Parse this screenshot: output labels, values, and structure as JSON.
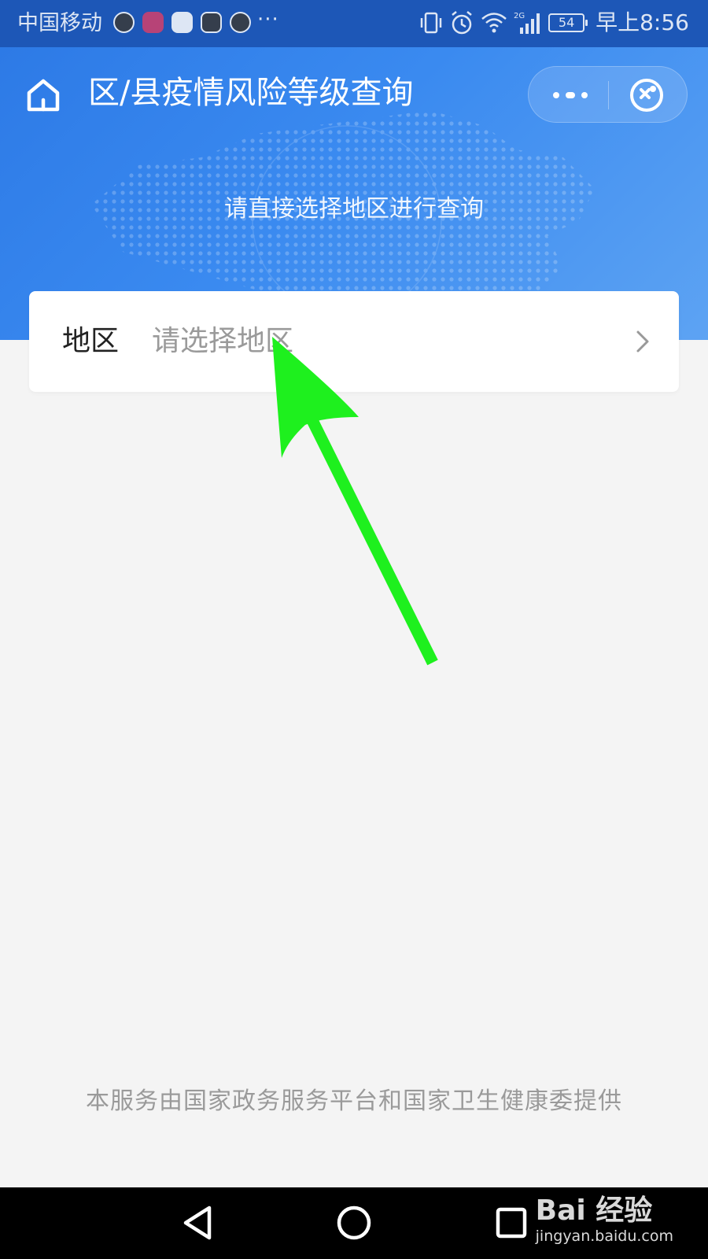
{
  "status_bar": {
    "carrier": "中国移动",
    "more": "···",
    "network": "2G",
    "battery": "54",
    "time": "早上8:56"
  },
  "header": {
    "title": "区/县疫情风险等级查询",
    "subtitle": "请直接选择地区进行查询",
    "background_color": "#2d7ae6"
  },
  "region_picker": {
    "label": "地区",
    "placeholder": "请选择地区"
  },
  "footer": {
    "note": "本服务由国家政务服务平台和国家卫生健康委提供"
  },
  "annotation": {
    "arrow_color": "#1ef01e"
  },
  "watermark": {
    "logo": "Bai 经验",
    "url": "jingyan.baidu.com"
  },
  "icons": {
    "home": "home-icon",
    "more": "more-dots-icon",
    "close": "close-miniprogram-icon",
    "chevron": "chevron-right-icon",
    "back": "back-triangle-icon",
    "home_circle": "home-circle-icon",
    "recents": "recents-square-icon"
  }
}
